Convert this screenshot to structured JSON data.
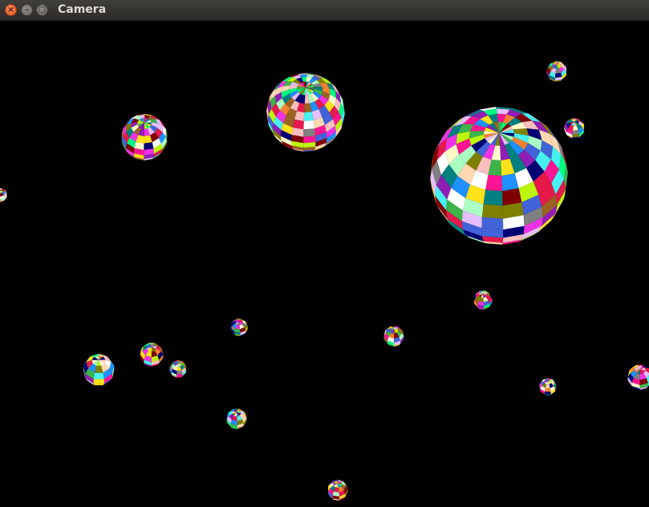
{
  "window": {
    "title": "Camera",
    "close_glyph": "×",
    "minimize_glyph": "–",
    "maximize_glyph": "□"
  },
  "scene": {
    "description_colors": [
      "#e6194b",
      "#3cb44b",
      "#ffe119",
      "#4363d8",
      "#f58231",
      "#911eb4",
      "#46f0f0",
      "#f032e6",
      "#bcf60c",
      "#fabebe",
      "#008080",
      "#e6beff",
      "#9a6324",
      "#fffac8",
      "#800000",
      "#aaffc3",
      "#808000",
      "#ffd8b1",
      "#000075",
      "#808080",
      "#ffffff",
      "#00ff7f",
      "#ff1493",
      "#1e90ff"
    ],
    "spheres": [
      {
        "name": "sphere-large"
      },
      {
        "name": "sphere-top-center"
      },
      {
        "name": "sphere-left-mid"
      },
      {
        "name": "sphere-top-right-small"
      },
      {
        "name": "sphere-right-small"
      },
      {
        "name": "sphere-left-edge"
      },
      {
        "name": "sphere-mid-right"
      },
      {
        "name": "sphere-center-small"
      },
      {
        "name": "sphere-center-right-small"
      },
      {
        "name": "sphere-bottom-left-1"
      },
      {
        "name": "sphere-bottom-left-2"
      },
      {
        "name": "sphere-bottom-left-3"
      },
      {
        "name": "sphere-bottom-right-small"
      },
      {
        "name": "sphere-right-edge"
      },
      {
        "name": "sphere-bottom-center-1"
      },
      {
        "name": "sphere-bottom-center-2"
      }
    ]
  }
}
